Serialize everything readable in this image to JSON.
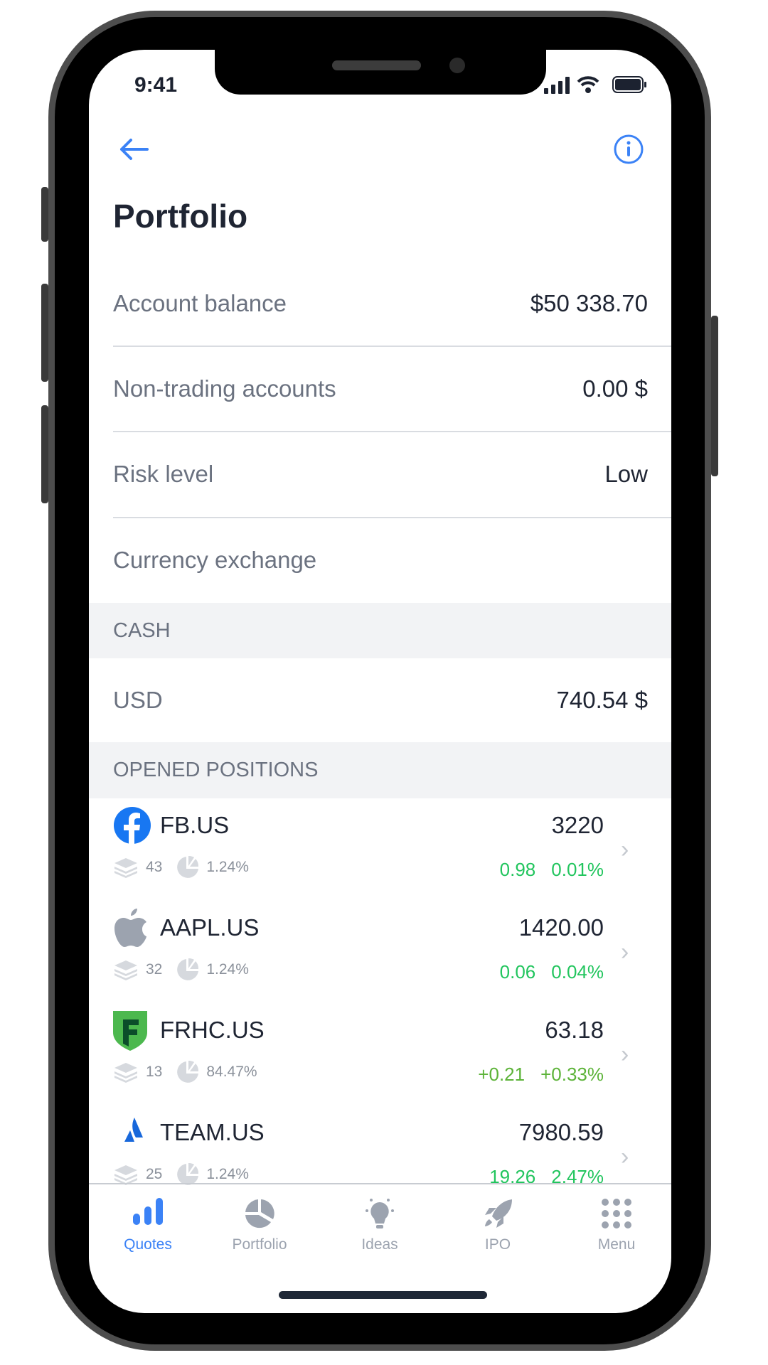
{
  "status_bar": {
    "time": "9:41"
  },
  "header": {
    "title": "Portfolio",
    "back_icon": "arrow-left-icon",
    "info_icon": "info-icon"
  },
  "summary": [
    {
      "label": "Account balance",
      "value": "$50 338.70"
    },
    {
      "label": "Non-trading accounts",
      "value": "0.00 $"
    },
    {
      "label": "Risk level",
      "value": "Low"
    },
    {
      "label": "Currency exchange",
      "value": ""
    }
  ],
  "cash": {
    "header": "CASH",
    "currency": "USD",
    "amount": "740.54 $"
  },
  "positions": {
    "header": "OPENED POSITIONS",
    "items": [
      {
        "ticker": "FB.US",
        "price": "3220",
        "qty": "43",
        "share": "1.24%",
        "change": "0.98",
        "change_pct": "0.01%",
        "logo": "facebook"
      },
      {
        "ticker": "AAPL.US",
        "price": "1420.00",
        "qty": "32",
        "share": "1.24%",
        "change": "0.06",
        "change_pct": "0.04%",
        "logo": "apple"
      },
      {
        "ticker": "FRHC.US",
        "price": "63.18",
        "qty": "13",
        "share": "84.47%",
        "change": "+0.21",
        "change_pct": "+0.33%",
        "logo": "freedom"
      },
      {
        "ticker": "TEAM.US",
        "price": "7980.59",
        "qty": "25",
        "share": "1.24%",
        "change": "19.26",
        "change_pct": "2.47%",
        "logo": "atlassian"
      }
    ]
  },
  "tabs": [
    {
      "label": "Quotes",
      "icon": "bar-chart-icon",
      "active": true
    },
    {
      "label": "Portfolio",
      "icon": "pie-chart-icon"
    },
    {
      "label": "Ideas",
      "icon": "lightbulb-icon"
    },
    {
      "label": "IPO",
      "icon": "rocket-icon"
    },
    {
      "label": "Menu",
      "icon": "grid-dots-icon"
    }
  ],
  "colors": {
    "accent": "#3b82f6",
    "positive": "#22c55e",
    "positive_alt": "#5cb338",
    "text": "#1f2533",
    "muted": "#6b7280"
  }
}
